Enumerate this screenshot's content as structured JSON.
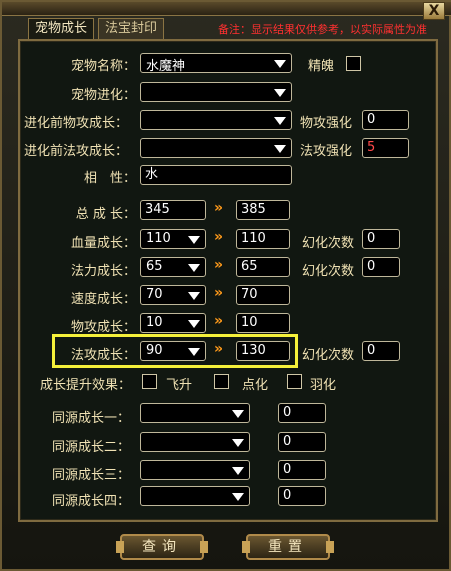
{
  "window": {
    "close_label": "X"
  },
  "tabs": [
    {
      "label": "宠物成长",
      "active": true
    },
    {
      "label": "法宝封印",
      "active": false
    }
  ],
  "notice": "备注：显示结果仅供参考，以实际属性为准",
  "form": {
    "pet_name_label": "宠物名称：",
    "pet_name_value": "水魔神",
    "spirit_label": "精魄",
    "pet_evolve_label": "宠物进化：",
    "pet_evolve_value": "",
    "pre_phys_growth_label": "进化前物攻成长：",
    "pre_phys_growth_value": "",
    "phys_enhance_label": "物攻强化",
    "phys_enhance_value": "0",
    "pre_magic_growth_label": "进化前法攻成长：",
    "pre_magic_growth_value": "",
    "magic_enhance_label": "法攻强化",
    "magic_enhance_value": "5",
    "attribute_label": "相　性：",
    "attribute_value": "水",
    "total_growth_label": "总 成 长：",
    "total_growth_from": "345",
    "total_growth_to": "385",
    "arrow": "»",
    "growth_rows": [
      {
        "label": "血量成长：",
        "from": "110",
        "to": "110",
        "conv_label": "幻化次数",
        "conv": "0"
      },
      {
        "label": "法力成长：",
        "from": "65",
        "to": "65",
        "conv_label": "幻化次数",
        "conv": "0"
      },
      {
        "label": "速度成长：",
        "from": "70",
        "to": "70",
        "conv_label": "",
        "conv": ""
      },
      {
        "label": "物攻成长：",
        "from": "10",
        "to": "10",
        "conv_label": "",
        "conv": ""
      },
      {
        "label": "法攻成长：",
        "from": "90",
        "to": "130",
        "conv_label": "幻化次数",
        "conv": "0"
      }
    ],
    "boost_label": "成长提升效果：",
    "boost_options": [
      "飞升",
      "点化",
      "羽化"
    ],
    "same_source": [
      {
        "label": "同源成长一：",
        "value": "",
        "count": "0"
      },
      {
        "label": "同源成长二：",
        "value": "",
        "count": "0"
      },
      {
        "label": "同源成长三：",
        "value": "",
        "count": "0"
      },
      {
        "label": "同源成长四：",
        "value": "",
        "count": "0"
      }
    ]
  },
  "buttons": {
    "query": "查询",
    "reset": "重置"
  }
}
